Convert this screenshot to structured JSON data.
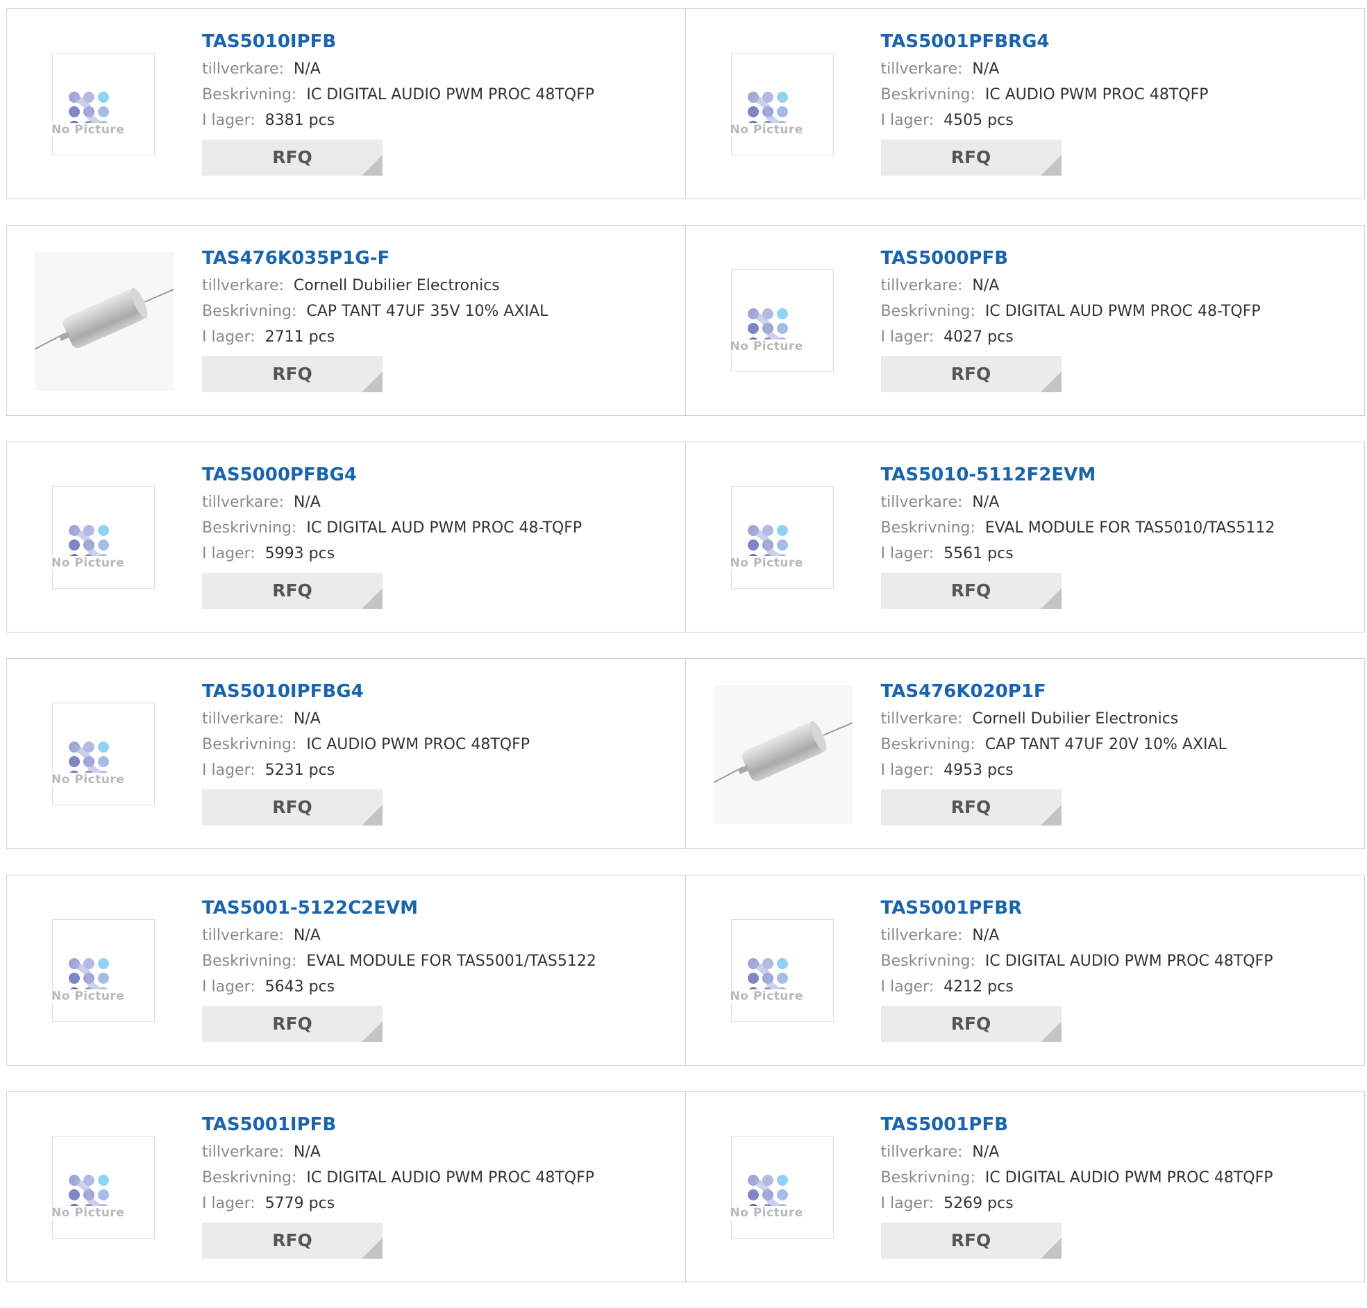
{
  "labels": {
    "manufacturer": "tillverkare:",
    "description": "Beskrivning:",
    "stock": "I lager:",
    "rfq": "RFQ",
    "no_picture": "No Picture"
  },
  "products": [
    {
      "part": "TAS5010IPFB",
      "manufacturer": "N/A",
      "description": "IC DIGITAL AUDIO PWM PROC 48TQFP",
      "stock": "8381 pcs",
      "image": "no-picture"
    },
    {
      "part": "TAS5001PFBRG4",
      "manufacturer": "N/A",
      "description": "IC AUDIO PWM PROC 48TQFP",
      "stock": "4505 pcs",
      "image": "no-picture"
    },
    {
      "part": "TAS476K035P1G-F",
      "manufacturer": "Cornell Dubilier Electronics",
      "description": "CAP TANT 47UF 35V 10% AXIAL",
      "stock": "2711 pcs",
      "image": "axial-capacitor"
    },
    {
      "part": "TAS5000PFB",
      "manufacturer": "N/A",
      "description": "IC DIGITAL AUD PWM PROC 48-TQFP",
      "stock": "4027 pcs",
      "image": "no-picture"
    },
    {
      "part": "TAS5000PFBG4",
      "manufacturer": "N/A",
      "description": "IC DIGITAL AUD PWM PROC 48-TQFP",
      "stock": "5993 pcs",
      "image": "no-picture"
    },
    {
      "part": "TAS5010-5112F2EVM",
      "manufacturer": "N/A",
      "description": "EVAL MODULE FOR TAS5010/TAS5112",
      "stock": "5561 pcs",
      "image": "no-picture"
    },
    {
      "part": "TAS5010IPFBG4",
      "manufacturer": "N/A",
      "description": "IC AUDIO PWM PROC 48TQFP",
      "stock": "5231 pcs",
      "image": "no-picture"
    },
    {
      "part": "TAS476K020P1F",
      "manufacturer": "Cornell Dubilier Electronics",
      "description": "CAP TANT 47UF 20V 10% AXIAL",
      "stock": "4953 pcs",
      "image": "axial-capacitor"
    },
    {
      "part": "TAS5001-5122C2EVM",
      "manufacturer": "N/A",
      "description": "EVAL MODULE FOR TAS5001/TAS5122",
      "stock": "5643 pcs",
      "image": "no-picture"
    },
    {
      "part": "TAS5001PFBR",
      "manufacturer": "N/A",
      "description": "IC DIGITAL AUDIO PWM PROC 48TQFP",
      "stock": "4212 pcs",
      "image": "no-picture"
    },
    {
      "part": "TAS5001IPFB",
      "manufacturer": "N/A",
      "description": "IC DIGITAL AUDIO PWM PROC 48TQFP",
      "stock": "5779 pcs",
      "image": "no-picture"
    },
    {
      "part": "TAS5001PFB",
      "manufacturer": "N/A",
      "description": "IC DIGITAL AUDIO PWM PROC 48TQFP",
      "stock": "5269 pcs",
      "image": "no-picture"
    }
  ],
  "colors": {
    "part_link": "#1a64ae",
    "label": "#8a8a8a",
    "value": "#333333",
    "rfq_bg": "#ebebeb",
    "border": "#cfcfcf"
  }
}
